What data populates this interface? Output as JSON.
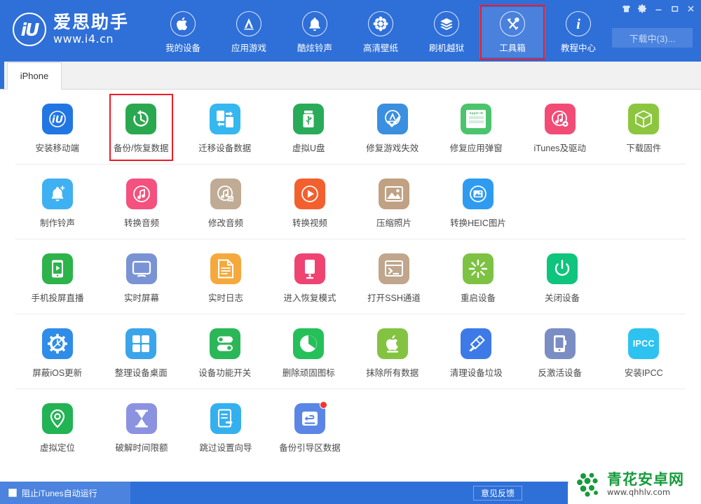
{
  "header": {
    "brand_mark": "iU",
    "brand_name": "爱思助手",
    "brand_url": "www.i4.cn",
    "download_label": "下载中(3)...",
    "nav": [
      {
        "label": "我的设备",
        "icon": "apple-icon",
        "active": false,
        "highlighted": false
      },
      {
        "label": "应用游戏",
        "icon": "appstore-icon",
        "active": false,
        "highlighted": false
      },
      {
        "label": "酷炫铃声",
        "icon": "bell-icon",
        "active": false,
        "highlighted": false
      },
      {
        "label": "高清壁纸",
        "icon": "wallpaper-icon",
        "active": false,
        "highlighted": false
      },
      {
        "label": "刷机越狱",
        "icon": "flash-box-icon",
        "active": false,
        "highlighted": false
      },
      {
        "label": "工具箱",
        "icon": "toolbox-icon",
        "active": true,
        "highlighted": true
      },
      {
        "label": "教程中心",
        "icon": "info-icon",
        "active": false,
        "highlighted": false
      }
    ],
    "window_buttons": [
      {
        "name": "skin-icon",
        "glyph": "\u0000"
      },
      {
        "name": "settings-gear-icon",
        "glyph": "\u0000"
      },
      {
        "name": "minimize-icon",
        "glyph": "\u0000"
      },
      {
        "name": "maximize-icon",
        "glyph": "\u0000"
      },
      {
        "name": "close-icon",
        "glyph": "\u0000"
      }
    ]
  },
  "tabs": [
    {
      "label": "iPhone",
      "active": true
    }
  ],
  "tools": {
    "rows": [
      [
        {
          "label": "安装移动端",
          "icon": "i4-app-icon",
          "color": "#2276e3",
          "highlighted": false
        },
        {
          "label": "备份/恢复数据",
          "icon": "backup-restore-icon",
          "color": "#2aa84f",
          "highlighted": true
        },
        {
          "label": "迁移设备数据",
          "icon": "migrate-device-icon",
          "color": "#35b7ef",
          "highlighted": false
        },
        {
          "label": "虚拟U盘",
          "icon": "usb-drive-icon",
          "color": "#2aab5a",
          "highlighted": false
        },
        {
          "label": "修复游戏失效",
          "icon": "fix-game-icon",
          "color": "#3a8fe0",
          "highlighted": false
        },
        {
          "label": "修复应用弹窗",
          "icon": "apple-id-icon",
          "color": "#4cc46e",
          "highlighted": false
        },
        {
          "label": "iTunes及驱动",
          "icon": "itunes-driver-icon",
          "color": "#f24b76",
          "highlighted": false
        },
        {
          "label": "下载固件",
          "icon": "firmware-box-icon",
          "color": "#8cc councillor",
          "highlighted": false
        }
      ],
      [
        {
          "label": "制作铃声",
          "icon": "make-ringtone-icon",
          "color": "#3fb0f2",
          "highlighted": false
        },
        {
          "label": "转换音频",
          "icon": "convert-audio-icon",
          "color": "#f4517f",
          "highlighted": false
        },
        {
          "label": "修改音频",
          "icon": "edit-audio-icon",
          "color": "#c0ab94",
          "highlighted": false
        },
        {
          "label": "转换视频",
          "icon": "convert-video-icon",
          "color": "#f2602e",
          "highlighted": false
        },
        {
          "label": "压缩照片",
          "icon": "compress-photo-icon",
          "color": "#c0a183",
          "highlighted": false
        },
        {
          "label": "转换HEIC图片",
          "icon": "heic-convert-icon",
          "color": "#2f9bf0",
          "highlighted": false
        }
      ],
      [
        {
          "label": "手机投屏直播",
          "icon": "screen-cast-icon",
          "color": "#2cb34a",
          "highlighted": false
        },
        {
          "label": "实时屏幕",
          "icon": "realtime-screen-icon",
          "color": "#7a93d4",
          "highlighted": false
        },
        {
          "label": "实时日志",
          "icon": "realtime-log-icon",
          "color": "#f5a93c",
          "highlighted": false
        },
        {
          "label": "进入恢复模式",
          "icon": "recovery-mode-icon",
          "color": "#ef4472",
          "highlighted": false
        },
        {
          "label": "打开SSH通道",
          "icon": "ssh-tunnel-icon",
          "color": "#bfa68c",
          "highlighted": false
        },
        {
          "label": "重启设备",
          "icon": "restart-device-icon",
          "color": "#7dc242",
          "highlighted": false
        },
        {
          "label": "关闭设备",
          "icon": "shutdown-device-icon",
          "color": "#0fc47c",
          "highlighted": false
        }
      ],
      [
        {
          "label": "屏蔽iOS更新",
          "icon": "block-ios-update-icon",
          "color": "#2f8ce8",
          "highlighted": false
        },
        {
          "label": "整理设备桌面",
          "icon": "organize-desktop-icon",
          "color": "#3aa5ea",
          "highlighted": false
        },
        {
          "label": "设备功能开关",
          "icon": "feature-toggle-icon",
          "color": "#2bb757",
          "highlighted": false
        },
        {
          "label": "删除顽固图标",
          "icon": "remove-icon-icon",
          "color": "#25c05a",
          "highlighted": false
        },
        {
          "label": "抹除所有数据",
          "icon": "erase-all-data-icon",
          "color": "#83c341",
          "highlighted": false
        },
        {
          "label": "清理设备垃圾",
          "icon": "clean-junk-icon",
          "color": "#3d7ae8",
          "highlighted": false
        },
        {
          "label": "反激活设备",
          "icon": "deactivate-device-icon",
          "color": "#7a8ec4",
          "highlighted": false
        },
        {
          "label": "安装IPCC",
          "icon": "install-ipcc-icon",
          "color": "#2ec2f0",
          "highlighted": false
        }
      ],
      [
        {
          "label": "虚拟定位",
          "icon": "virtual-location-icon",
          "color": "#22b355",
          "highlighted": false
        },
        {
          "label": "破解时间限额",
          "icon": "crack-screentime-icon",
          "color": "#8b93e0",
          "highlighted": false
        },
        {
          "label": "跳过设置向导",
          "icon": "skip-setup-icon",
          "color": "#35b0ef",
          "highlighted": false
        },
        {
          "label": "备份引导区数据",
          "icon": "backup-boot-icon",
          "color": "#5b86e5",
          "highlighted": false,
          "badge": true
        }
      ]
    ]
  },
  "statusbar": {
    "block_itunes_label": "阻止iTunes自动运行",
    "feedback_label": "意见反馈"
  },
  "watermark": {
    "title": "青花安卓网",
    "url": "www.qhhlv.com"
  }
}
